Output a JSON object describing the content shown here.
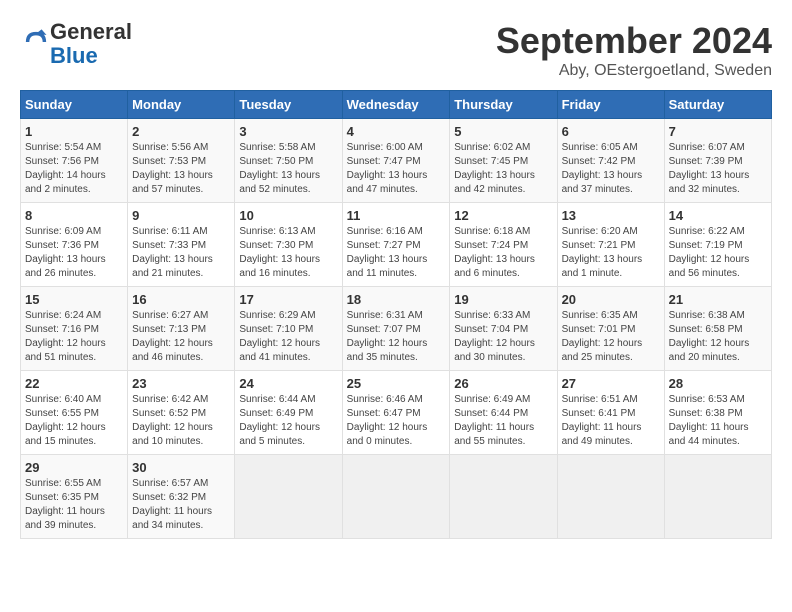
{
  "logo": {
    "general": "General",
    "blue": "Blue"
  },
  "header": {
    "month": "September 2024",
    "location": "Aby, OEstergoetland, Sweden"
  },
  "weekdays": [
    "Sunday",
    "Monday",
    "Tuesday",
    "Wednesday",
    "Thursday",
    "Friday",
    "Saturday"
  ],
  "weeks": [
    [
      {
        "day": "1",
        "sunrise": "Sunrise: 5:54 AM",
        "sunset": "Sunset: 7:56 PM",
        "daylight": "Daylight: 14 hours and 2 minutes."
      },
      {
        "day": "2",
        "sunrise": "Sunrise: 5:56 AM",
        "sunset": "Sunset: 7:53 PM",
        "daylight": "Daylight: 13 hours and 57 minutes."
      },
      {
        "day": "3",
        "sunrise": "Sunrise: 5:58 AM",
        "sunset": "Sunset: 7:50 PM",
        "daylight": "Daylight: 13 hours and 52 minutes."
      },
      {
        "day": "4",
        "sunrise": "Sunrise: 6:00 AM",
        "sunset": "Sunset: 7:47 PM",
        "daylight": "Daylight: 13 hours and 47 minutes."
      },
      {
        "day": "5",
        "sunrise": "Sunrise: 6:02 AM",
        "sunset": "Sunset: 7:45 PM",
        "daylight": "Daylight: 13 hours and 42 minutes."
      },
      {
        "day": "6",
        "sunrise": "Sunrise: 6:05 AM",
        "sunset": "Sunset: 7:42 PM",
        "daylight": "Daylight: 13 hours and 37 minutes."
      },
      {
        "day": "7",
        "sunrise": "Sunrise: 6:07 AM",
        "sunset": "Sunset: 7:39 PM",
        "daylight": "Daylight: 13 hours and 32 minutes."
      }
    ],
    [
      {
        "day": "8",
        "sunrise": "Sunrise: 6:09 AM",
        "sunset": "Sunset: 7:36 PM",
        "daylight": "Daylight: 13 hours and 26 minutes."
      },
      {
        "day": "9",
        "sunrise": "Sunrise: 6:11 AM",
        "sunset": "Sunset: 7:33 PM",
        "daylight": "Daylight: 13 hours and 21 minutes."
      },
      {
        "day": "10",
        "sunrise": "Sunrise: 6:13 AM",
        "sunset": "Sunset: 7:30 PM",
        "daylight": "Daylight: 13 hours and 16 minutes."
      },
      {
        "day": "11",
        "sunrise": "Sunrise: 6:16 AM",
        "sunset": "Sunset: 7:27 PM",
        "daylight": "Daylight: 13 hours and 11 minutes."
      },
      {
        "day": "12",
        "sunrise": "Sunrise: 6:18 AM",
        "sunset": "Sunset: 7:24 PM",
        "daylight": "Daylight: 13 hours and 6 minutes."
      },
      {
        "day": "13",
        "sunrise": "Sunrise: 6:20 AM",
        "sunset": "Sunset: 7:21 PM",
        "daylight": "Daylight: 13 hours and 1 minute."
      },
      {
        "day": "14",
        "sunrise": "Sunrise: 6:22 AM",
        "sunset": "Sunset: 7:19 PM",
        "daylight": "Daylight: 12 hours and 56 minutes."
      }
    ],
    [
      {
        "day": "15",
        "sunrise": "Sunrise: 6:24 AM",
        "sunset": "Sunset: 7:16 PM",
        "daylight": "Daylight: 12 hours and 51 minutes."
      },
      {
        "day": "16",
        "sunrise": "Sunrise: 6:27 AM",
        "sunset": "Sunset: 7:13 PM",
        "daylight": "Daylight: 12 hours and 46 minutes."
      },
      {
        "day": "17",
        "sunrise": "Sunrise: 6:29 AM",
        "sunset": "Sunset: 7:10 PM",
        "daylight": "Daylight: 12 hours and 41 minutes."
      },
      {
        "day": "18",
        "sunrise": "Sunrise: 6:31 AM",
        "sunset": "Sunset: 7:07 PM",
        "daylight": "Daylight: 12 hours and 35 minutes."
      },
      {
        "day": "19",
        "sunrise": "Sunrise: 6:33 AM",
        "sunset": "Sunset: 7:04 PM",
        "daylight": "Daylight: 12 hours and 30 minutes."
      },
      {
        "day": "20",
        "sunrise": "Sunrise: 6:35 AM",
        "sunset": "Sunset: 7:01 PM",
        "daylight": "Daylight: 12 hours and 25 minutes."
      },
      {
        "day": "21",
        "sunrise": "Sunrise: 6:38 AM",
        "sunset": "Sunset: 6:58 PM",
        "daylight": "Daylight: 12 hours and 20 minutes."
      }
    ],
    [
      {
        "day": "22",
        "sunrise": "Sunrise: 6:40 AM",
        "sunset": "Sunset: 6:55 PM",
        "daylight": "Daylight: 12 hours and 15 minutes."
      },
      {
        "day": "23",
        "sunrise": "Sunrise: 6:42 AM",
        "sunset": "Sunset: 6:52 PM",
        "daylight": "Daylight: 12 hours and 10 minutes."
      },
      {
        "day": "24",
        "sunrise": "Sunrise: 6:44 AM",
        "sunset": "Sunset: 6:49 PM",
        "daylight": "Daylight: 12 hours and 5 minutes."
      },
      {
        "day": "25",
        "sunrise": "Sunrise: 6:46 AM",
        "sunset": "Sunset: 6:47 PM",
        "daylight": "Daylight: 12 hours and 0 minutes."
      },
      {
        "day": "26",
        "sunrise": "Sunrise: 6:49 AM",
        "sunset": "Sunset: 6:44 PM",
        "daylight": "Daylight: 11 hours and 55 minutes."
      },
      {
        "day": "27",
        "sunrise": "Sunrise: 6:51 AM",
        "sunset": "Sunset: 6:41 PM",
        "daylight": "Daylight: 11 hours and 49 minutes."
      },
      {
        "day": "28",
        "sunrise": "Sunrise: 6:53 AM",
        "sunset": "Sunset: 6:38 PM",
        "daylight": "Daylight: 11 hours and 44 minutes."
      }
    ],
    [
      {
        "day": "29",
        "sunrise": "Sunrise: 6:55 AM",
        "sunset": "Sunset: 6:35 PM",
        "daylight": "Daylight: 11 hours and 39 minutes."
      },
      {
        "day": "30",
        "sunrise": "Sunrise: 6:57 AM",
        "sunset": "Sunset: 6:32 PM",
        "daylight": "Daylight: 11 hours and 34 minutes."
      },
      null,
      null,
      null,
      null,
      null
    ]
  ]
}
